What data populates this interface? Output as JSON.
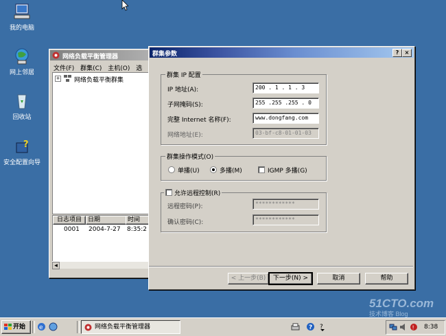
{
  "desktop": {
    "icons": [
      {
        "label": "我的电脑",
        "icon": "my-computer-icon"
      },
      {
        "label": "网上邻居",
        "icon": "network-places-icon"
      },
      {
        "label": "回收站",
        "icon": "recycle-bin-icon"
      },
      {
        "label": "安全配置向导",
        "icon": "security-wizard-icon"
      }
    ],
    "watermark": {
      "line1": "51CTO.com",
      "line2": "技术博客 Blog"
    }
  },
  "nlb_window": {
    "title": "网络负载平衡管理器",
    "menu": [
      "文件(F)",
      "群集(C)",
      "主机(O)",
      "选"
    ],
    "tree_item": "网络负载平衡群集",
    "log_columns": [
      "日志项目",
      "日期",
      "时间"
    ],
    "log_rows": [
      {
        "item": "0001",
        "date": "2004-7-27",
        "time": "8:35:2"
      }
    ]
  },
  "dialog": {
    "title": "群集参数",
    "help_btn": "?",
    "close_btn": "×",
    "ip_group": {
      "title": "群集 IP 配置",
      "ip_label": "IP 地址(A):",
      "ip_value": "200 . 1  . 1  . 3",
      "mask_label": "子网掩码(S):",
      "mask_value": "255 .255 .255 . 0",
      "fqdn_label": "完整 Internet 名称(F):",
      "fqdn_value": "www.dongfang.com",
      "mac_label": "网络地址(E):",
      "mac_value": "03-bf-c8-01-01-03"
    },
    "mode_group": {
      "title": "群集操作模式(O)",
      "unicast": "单播(U)",
      "multicast": "多播(M)",
      "igmp": "IGMP 多播(G)",
      "selected": "multicast"
    },
    "remote_group": {
      "checkbox": "允许远程控制(R)",
      "pw_label": "远程密码(P):",
      "pw_value": "************",
      "confirm_label": "确认密码(C):",
      "confirm_value": "************"
    },
    "buttons": {
      "back": "< 上一步(B)",
      "next": "下一步(N) >",
      "cancel": "取消",
      "help": "帮助"
    }
  },
  "taskbar": {
    "start": "开始",
    "task": "网络负载平衡管理器",
    "clock": "8:38"
  }
}
